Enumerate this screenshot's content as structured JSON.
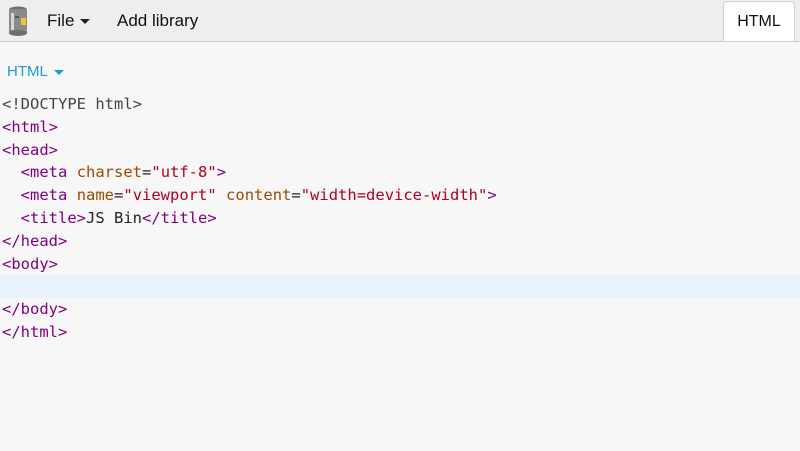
{
  "toolbar": {
    "file_label": "File",
    "add_library_label": "Add library",
    "html_tab_label": "HTML"
  },
  "panel": {
    "label": "HTML"
  },
  "code": {
    "line1": "<!DOCTYPE html>",
    "line2_tag": "<html>",
    "line3_tag": "<head>",
    "line4": {
      "indent": "  ",
      "open": "<meta",
      "attr": "charset",
      "eq": "=",
      "val": "\"utf-8\"",
      "close": ">"
    },
    "line5": {
      "indent": "  ",
      "open": "<meta",
      "attr1": "name",
      "eq1": "=",
      "val1": "\"viewport\"",
      "attr2": "content",
      "eq2": "=",
      "val2": "\"width=device-width\"",
      "close": ">"
    },
    "line6": {
      "indent": "  ",
      "open": "<title>",
      "text": "JS Bin",
      "close": "</title>"
    },
    "line7_tag": "</head>",
    "line8_tag": "<body>",
    "line10_tag": "</body>",
    "line11_tag": "</html>"
  },
  "colors": {
    "accent": "#1e9ad6",
    "tag": "#800080",
    "attribute": "#9a4a00",
    "string": "#b00020",
    "active_line": "#e8f2ff"
  },
  "icons": {
    "logo": "jsbin-logo-icon"
  }
}
